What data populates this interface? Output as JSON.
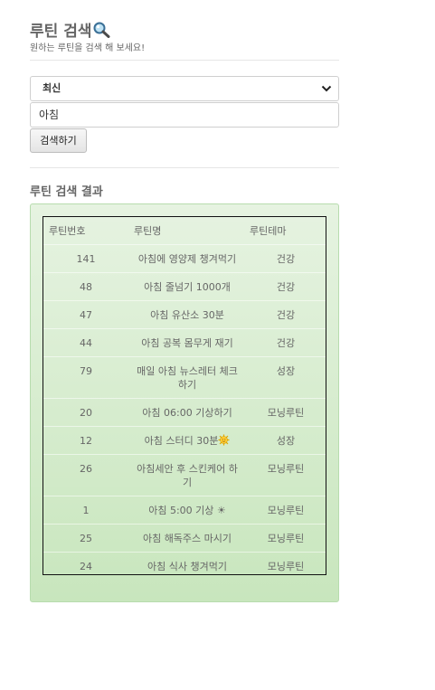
{
  "header": {
    "title": "루틴 검색",
    "subtitle": "원하는 루틴을 검색 해 보세요!"
  },
  "search": {
    "sort_value": "최신",
    "query_value": "아침",
    "button_label": "검색하기"
  },
  "results": {
    "title": "루틴 검색 결과",
    "columns": [
      "루틴번호",
      "루틴명",
      "루틴테마"
    ],
    "rows": [
      {
        "id": "141",
        "name": "아침에 영양제 챙겨먹기",
        "theme": "건강"
      },
      {
        "id": "48",
        "name": "아침 줄넘기 1000개",
        "theme": "건강"
      },
      {
        "id": "47",
        "name": "아침 유산소 30분",
        "theme": "건강"
      },
      {
        "id": "44",
        "name": "아침 공복 몸무게 재기",
        "theme": "건강"
      },
      {
        "id": "79",
        "name": "매일 아침 뉴스레터 체크하기",
        "theme": "성장"
      },
      {
        "id": "20",
        "name": "아침 06:00 기상하기",
        "theme": "모닝루틴"
      },
      {
        "id": "12",
        "name": "아침 스터디 30분",
        "theme": "성장",
        "icon": "sun-icon"
      },
      {
        "id": "26",
        "name": "아침세안 후 스킨케어 하기",
        "theme": "모닝루틴"
      },
      {
        "id": "1",
        "name": "아침 5:00 기상 ☀",
        "theme": "모닝루틴"
      },
      {
        "id": "25",
        "name": "아침 해독주스 마시기",
        "theme": "모닝루틴"
      },
      {
        "id": "24",
        "name": "아침 식사 챙겨먹기",
        "theme": "모닝루틴"
      }
    ]
  }
}
